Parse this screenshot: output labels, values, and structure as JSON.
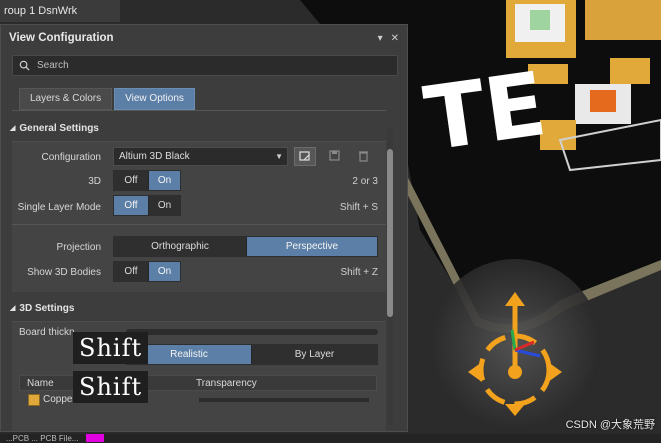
{
  "background": {
    "top_tab_text": "roup 1 DsnWrk",
    "board_silkscreen": "TE",
    "bottom_bar_text": "...PCB ... PCB File...",
    "watermark": "CSDN @大象荒野"
  },
  "panel": {
    "title": "View Configuration",
    "pin_icon": "pin-icon",
    "close_icon": "close-icon",
    "search_placeholder": "Search",
    "tabs": [
      {
        "label": "Layers & Colors",
        "active": false
      },
      {
        "label": "View Options",
        "active": true
      }
    ],
    "general_settings": {
      "title": "General Settings",
      "configuration_label": "Configuration",
      "configuration_value": "Altium 3D Black",
      "view_3d": {
        "label": "3D",
        "off": "Off",
        "on": "On",
        "selected": "On",
        "shortcut": "2 or 3"
      },
      "single_layer_mode": {
        "label": "Single Layer Mode",
        "off": "Off",
        "on": "On",
        "selected": "Off",
        "shortcut": "Shift + S"
      },
      "projection": {
        "label": "Projection",
        "options": [
          "Orthographic",
          "Perspective"
        ],
        "selected": "Perspective"
      },
      "show_3d_bodies": {
        "label": "Show 3D Bodies",
        "off": "Off",
        "on": "On",
        "selected": "On",
        "shortcut": "Shift + Z"
      }
    },
    "settings_3d": {
      "title": "3D Settings",
      "board_thickness_label": "Board thickn...",
      "mode_options": [
        "Realistic",
        "By Layer"
      ],
      "mode_selected": "Realistic",
      "table_headers": {
        "name": "Name",
        "transparency": "Transparency"
      },
      "rows": [
        {
          "name": "Copper"
        }
      ]
    },
    "overlay_keys": [
      "Shift",
      "Shift"
    ]
  },
  "colors": {
    "accent": "#5b7fa6",
    "panel_bg": "#3d3d3d",
    "gizmo": "#f2a21c"
  }
}
